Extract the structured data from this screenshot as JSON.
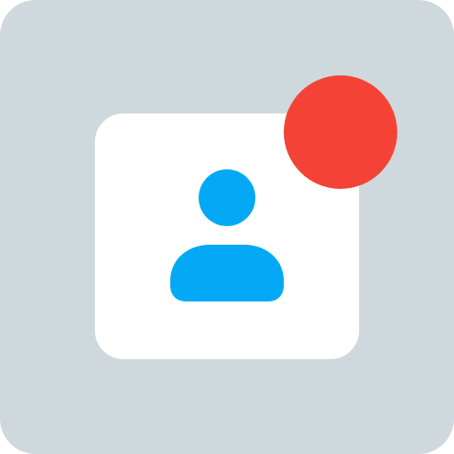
{
  "icon": {
    "name": "user-notification-icon",
    "colors": {
      "background_tile": "#cfd8dd",
      "card": "#ffffff",
      "person": "#03a9f4",
      "notification_dot": "#f44336"
    },
    "badge": {
      "visible": true,
      "icon": "notification-dot-icon"
    },
    "avatar": {
      "icon": "person-icon"
    }
  }
}
